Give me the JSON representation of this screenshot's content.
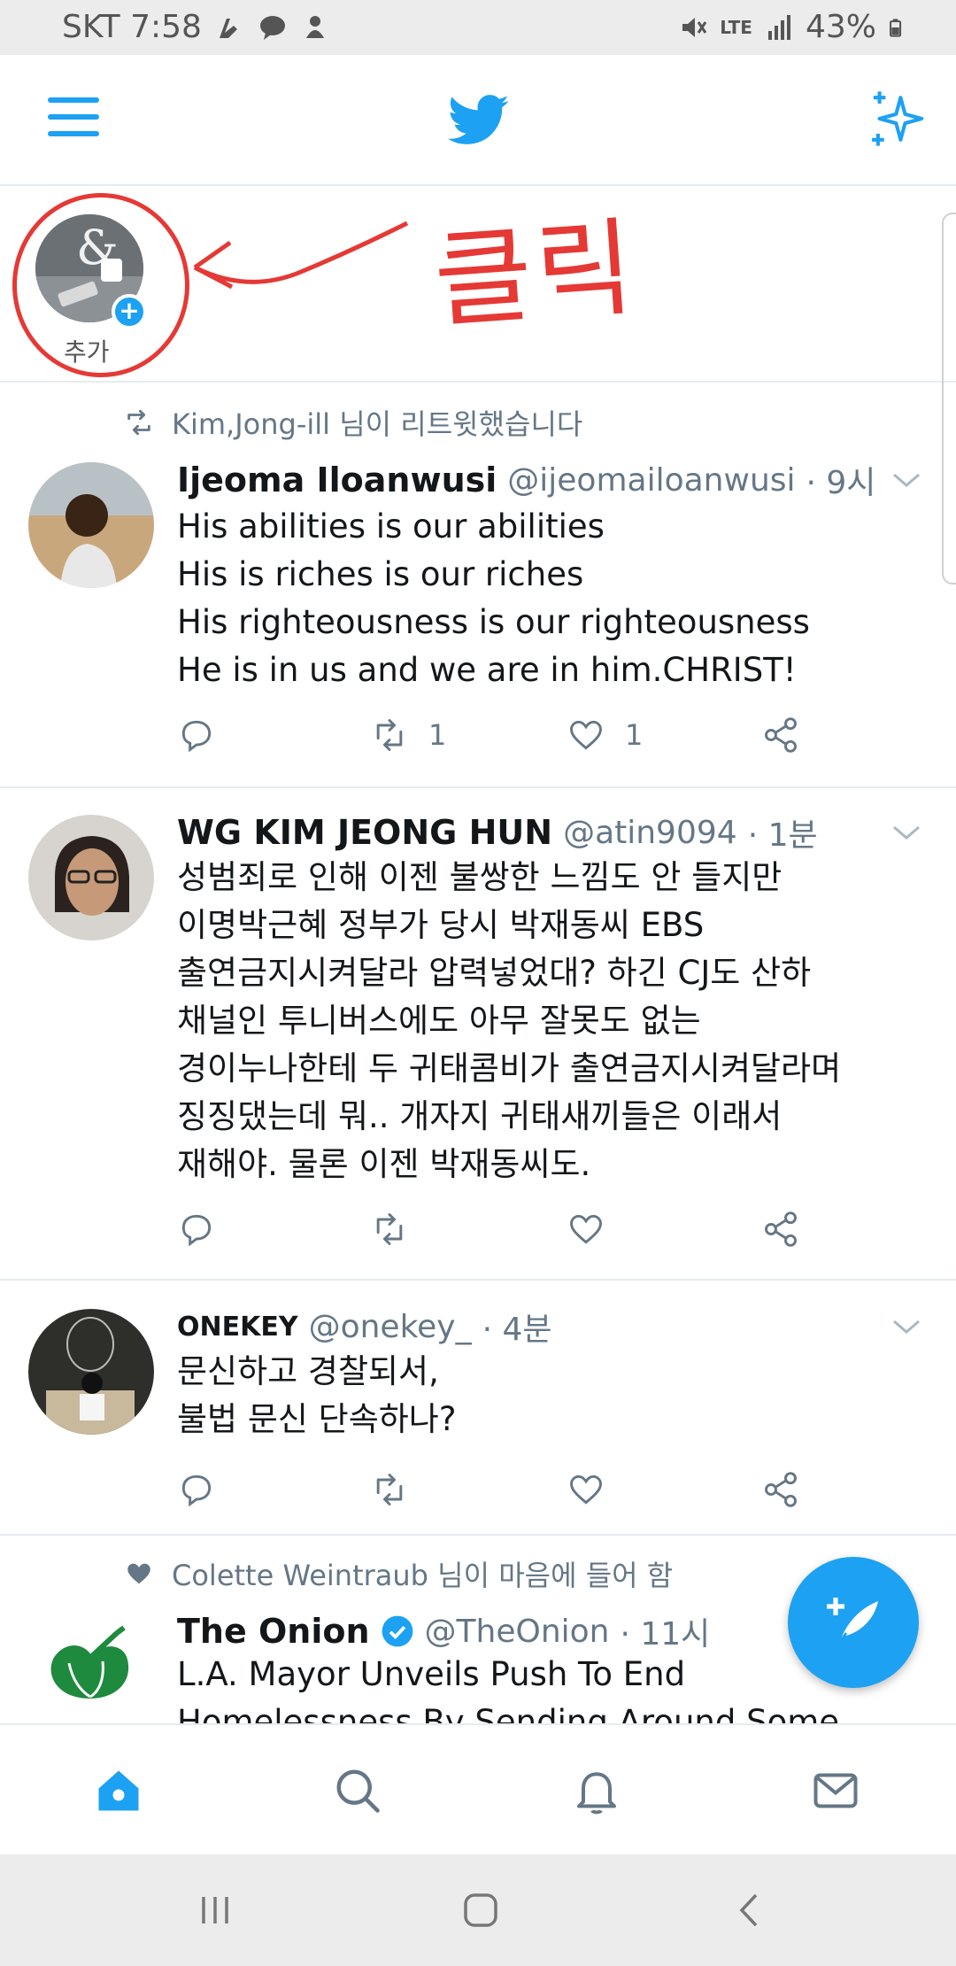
{
  "status_bar": {
    "carrier_time": "SKT 7:58",
    "network": "LTE",
    "battery": "43%"
  },
  "fleets": {
    "add_label": "추가",
    "annotation_text": "클릭"
  },
  "tweets": [
    {
      "social_context": "Kim,Jong-ill 님이 리트윗했습니다",
      "social_icon": "retweet-icon",
      "name": "Ijeoma Iloanwusi",
      "handle": "@ijeomailoanwusi",
      "time": "· 9시",
      "lines": [
        "His abilities is our abilities",
        "His is riches is our riches",
        "His righteousness is our righteousness",
        "He is in us and we are in him.CHRIST!"
      ],
      "retweets": "1",
      "likes": "1"
    },
    {
      "name": "WG KIM JEONG HUN",
      "handle": "@atin9094",
      "time": "· 1분",
      "lines": [
        "성범죄로 인해 이젠 불쌍한 느낌도 안 들지만",
        "이명박근혜 정부가 당시 박재동씨 EBS",
        "출연금지시켜달라 압력넣었대? 하긴 CJ도 산하",
        "채널인 투니버스에도 아무 잘못도 없는",
        "경이누나한테 두 귀태콤비가 출연금지시켜달라며",
        "징징댔는데 뭐.. 개자지 귀태새끼들은 이래서",
        "재해야. 물론 이젠 박재동씨도."
      ]
    },
    {
      "name": "ONEKEY",
      "handle": "@onekey_",
      "time": "· 4분",
      "lines": [
        "문신하고 경찰되서,",
        "불법 문신 단속하나?"
      ]
    },
    {
      "social_context": "Colette Weintraub 님이 마음에 들어 함",
      "social_icon": "heart-filled-icon",
      "name": "The Onion",
      "handle": "@TheOnion",
      "time": "· 11시",
      "lines": [
        "L.A. Mayor Unveils Push To End",
        "Homelessness By Sending Around Some"
      ]
    }
  ],
  "colors": {
    "accent": "#1da1f2",
    "annotation": "#e53935",
    "secondary_text": "#657786"
  }
}
